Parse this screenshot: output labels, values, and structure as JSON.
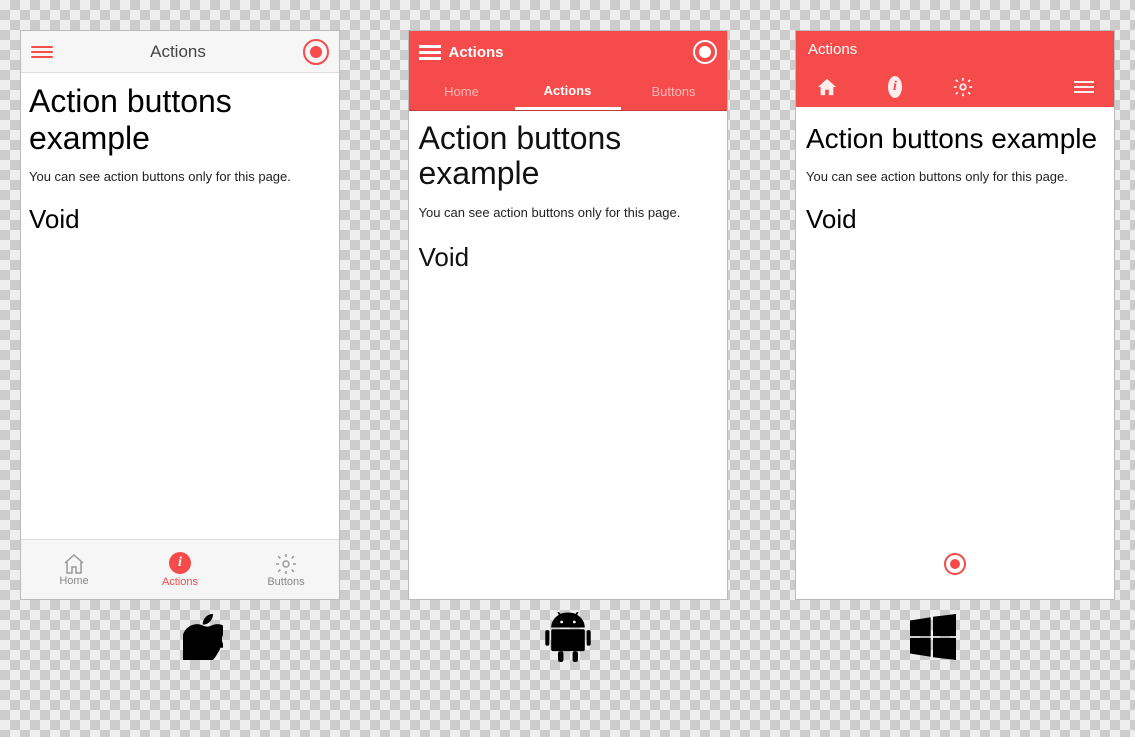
{
  "ios": {
    "header_title": "Actions",
    "heading": "Action buttons example",
    "subtext": "You can see action buttons only for this page.",
    "void": "Void",
    "tabs": [
      {
        "label": "Home"
      },
      {
        "label": "Actions"
      },
      {
        "label": "Buttons"
      }
    ]
  },
  "android": {
    "header_title": "Actions",
    "tabs": [
      {
        "label": "Home"
      },
      {
        "label": "Actions"
      },
      {
        "label": "Buttons"
      }
    ],
    "heading": "Action buttons example",
    "subtext": "You can see action buttons only for this page.",
    "void": "Void"
  },
  "windows": {
    "header_title": "Actions",
    "heading": "Action buttons example",
    "subtext": "You can see action buttons only for this page.",
    "void": "Void"
  },
  "info_glyph": "i"
}
